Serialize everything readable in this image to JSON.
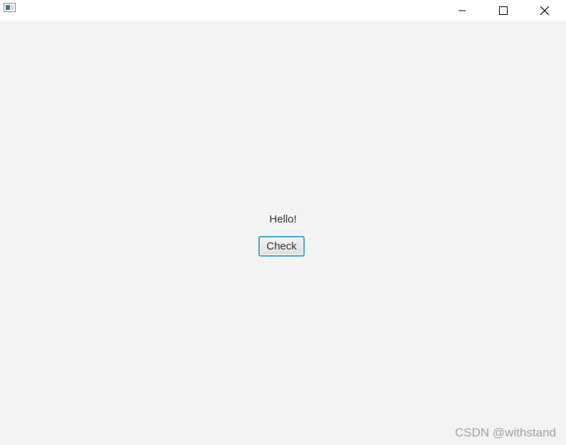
{
  "window": {
    "icons": {
      "app": "app-window-icon",
      "minimize": "minimize-icon",
      "maximize": "maximize-icon",
      "close": "close-icon"
    }
  },
  "main": {
    "label_text": "Hello!",
    "button_label": "Check"
  },
  "watermark": {
    "text": "CSDN @withstand"
  },
  "colors": {
    "content_bg": "#f3f3f3",
    "button_focus_border": "#39a7dc"
  }
}
